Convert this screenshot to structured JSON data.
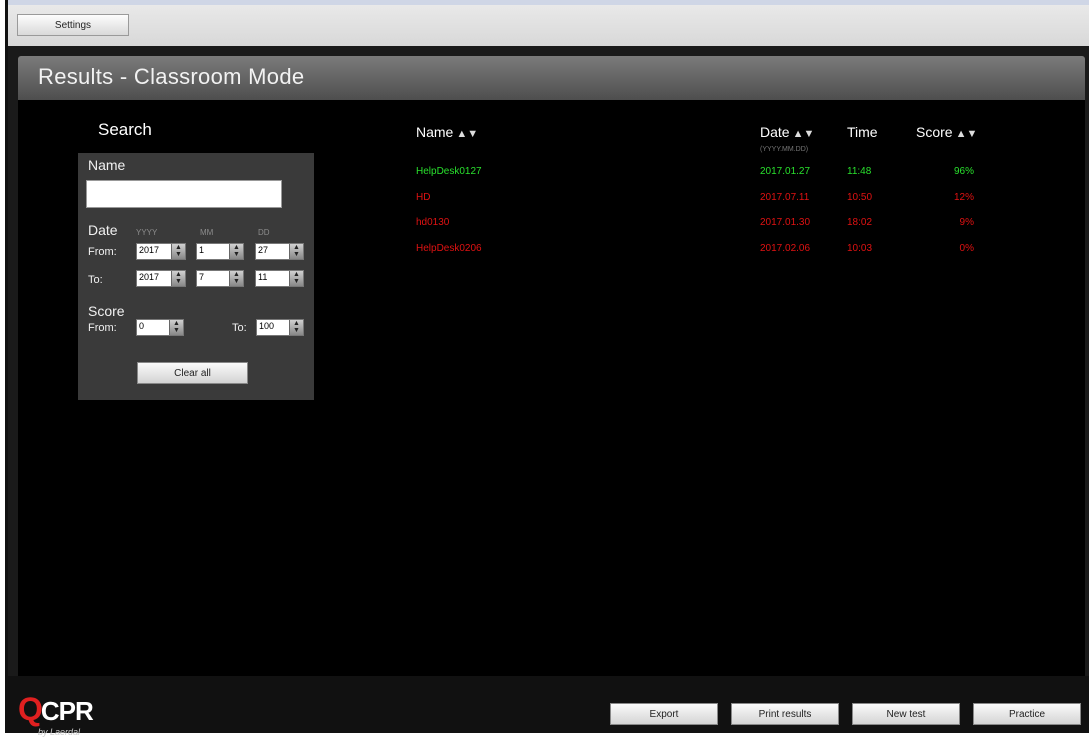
{
  "topbar": {
    "settings_label": "Settings"
  },
  "window": {
    "title": "Results - Classroom Mode"
  },
  "search": {
    "title": "Search",
    "name_label": "Name",
    "name_value": "",
    "date_label": "Date",
    "yyyy_hint": "YYYY",
    "mm_hint": "MM",
    "dd_hint": "DD",
    "from_label": "From:",
    "to_label": "To:",
    "date_from": {
      "yyyy": "2017",
      "mm": "1",
      "dd": "27"
    },
    "date_to": {
      "yyyy": "2017",
      "mm": "7",
      "dd": "11"
    },
    "score_label": "Score",
    "score_from_label": "From:",
    "score_to_label": "To:",
    "score_from": "0",
    "score_to": "100",
    "clear_label": "Clear all"
  },
  "results": {
    "headers": {
      "name": "Name",
      "date": "Date",
      "date_format": "(YYYY.MM.DD)",
      "time": "Time",
      "score": "Score"
    },
    "rows": [
      {
        "name": "HelpDesk0127",
        "date": "2017.01.27",
        "time": "11:48",
        "score": "96%",
        "status": "pass"
      },
      {
        "name": "HD",
        "date": "2017.07.11",
        "time": "10:50",
        "score": "12%",
        "status": "fail"
      },
      {
        "name": "hd0130",
        "date": "2017.01.30",
        "time": "18:02",
        "score": "9%",
        "status": "fail"
      },
      {
        "name": "HelpDesk0206",
        "date": "2017.02.06",
        "time": "10:03",
        "score": "0%",
        "status": "fail"
      }
    ],
    "colors": {
      "pass": "#29e02d",
      "fail": "#e01212"
    }
  },
  "footer": {
    "logo_q": "Q",
    "logo_cpr": "CPR",
    "logo_by": "by Laerdal",
    "buttons": {
      "export": "Export",
      "print": "Print results",
      "new_test": "New test",
      "practice": "Practice"
    }
  }
}
